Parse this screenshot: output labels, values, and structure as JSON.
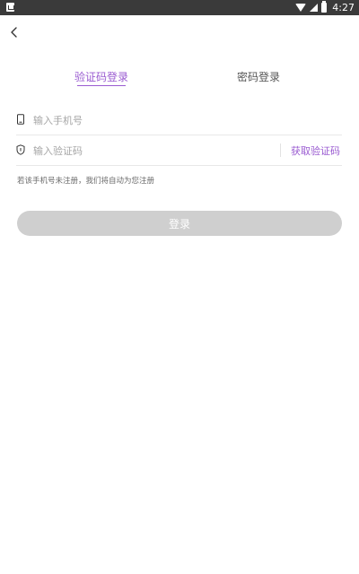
{
  "status_bar": {
    "time": "4:27",
    "icons": [
      "notification-icon",
      "wifi-icon",
      "signal-icon",
      "battery-icon"
    ]
  },
  "nav": {
    "back_icon": "chevron-left-icon"
  },
  "tabs": [
    {
      "label": "验证码登录",
      "active": true
    },
    {
      "label": "密码登录",
      "active": false
    }
  ],
  "form": {
    "phone": {
      "placeholder": "输入手机号",
      "value": "",
      "icon": "phone-icon"
    },
    "code": {
      "placeholder": "输入验证码",
      "value": "",
      "icon": "shield-icon"
    },
    "get_code_label": "获取验证码",
    "hint": "若该手机号未注册，我们将自动为您注册",
    "submit_label": "登录"
  },
  "colors": {
    "accent": "#9a5bd1",
    "button_disabled": "#cfcfcf",
    "status_bar": "#3a3a3a"
  }
}
